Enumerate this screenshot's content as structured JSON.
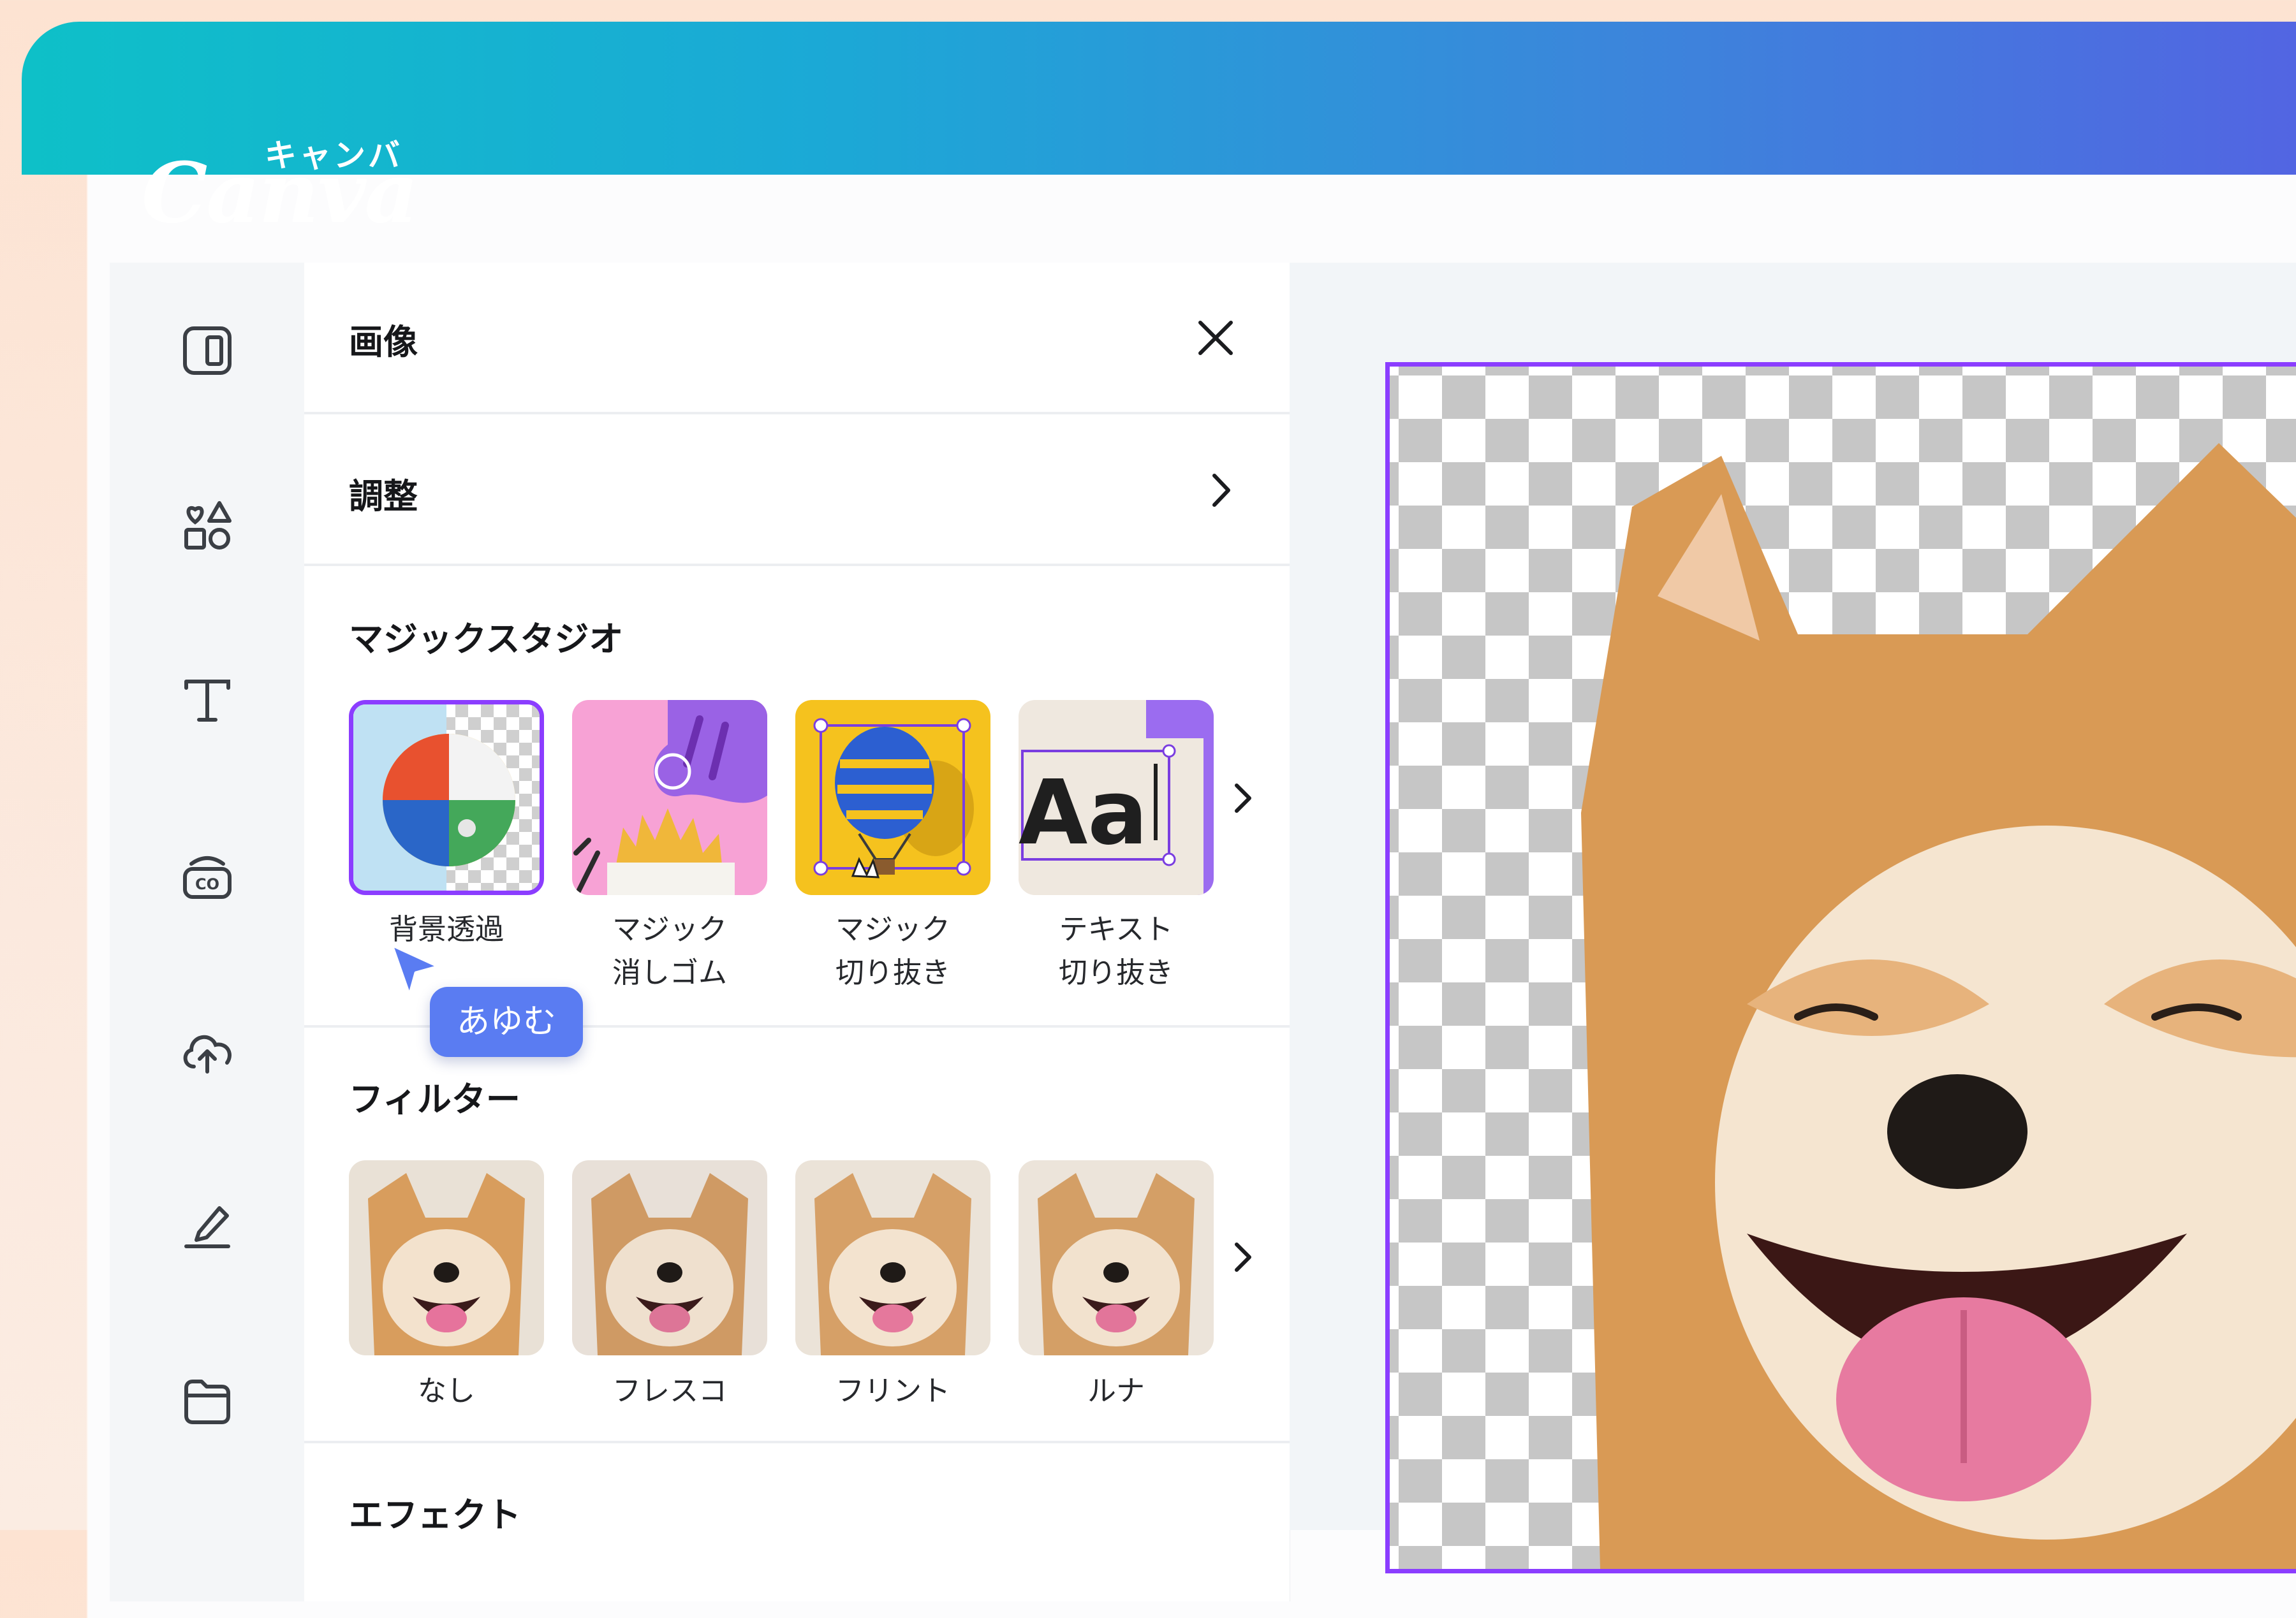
{
  "brand": {
    "logo_text": "Canva",
    "logo_kana": "キャンバ"
  },
  "panel": {
    "title": "画像",
    "adjust_label": "調整",
    "magic_studio": {
      "title": "マジックスタジオ",
      "items": [
        {
          "label_line1": "背景透過",
          "label_line2": ""
        },
        {
          "label_line1": "マジック",
          "label_line2": "消しゴム"
        },
        {
          "label_line1": "マジック",
          "label_line2": "切り抜き"
        },
        {
          "label_line1": "テキスト",
          "label_line2": "切り抜き"
        }
      ],
      "text_tile_glyph": "Aa"
    },
    "filters": {
      "title": "フィルター",
      "items": [
        "なし",
        "フレスコ",
        "フリント",
        "ルナ"
      ]
    },
    "effects": {
      "title": "エフェクト"
    }
  },
  "collaborator": {
    "name": "あゆむ"
  },
  "colors": {
    "accent": "#8b3dff",
    "cursor": "#5a7cf2",
    "header_start": "#0ec0c8",
    "header_end": "#5265e2"
  }
}
